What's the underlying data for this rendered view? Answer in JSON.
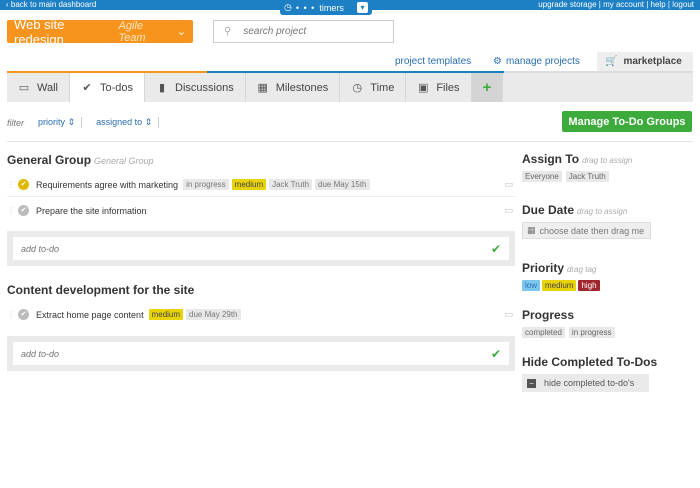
{
  "topbar": {
    "back": "back to main dashboard",
    "links": [
      "upgrade storage",
      "my account",
      "help",
      "logout"
    ],
    "separator": " | "
  },
  "timers": {
    "label": "timers",
    "dots": "• • •"
  },
  "project": {
    "name": "Web site redesign",
    "team": "Agile Team"
  },
  "search": {
    "placeholder": "search project"
  },
  "project_links": {
    "templates": "project templates",
    "manage": "manage projects",
    "marketplace": "marketplace"
  },
  "tabs": [
    {
      "label": "Wall",
      "icon": "speech-bubble-icon"
    },
    {
      "label": "To-dos",
      "icon": "checkmark-icon"
    },
    {
      "label": "Discussions",
      "icon": "discussion-icon"
    },
    {
      "label": "Milestones",
      "icon": "calendar-icon"
    },
    {
      "label": "Time",
      "icon": "clock-icon"
    },
    {
      "label": "Files",
      "icon": "briefcase-icon"
    },
    {
      "label": "+",
      "icon": "plus-icon"
    }
  ],
  "filter": {
    "label": "filter",
    "priority": "priority",
    "assigned": "assigned to",
    "sort_glyph": "⇕"
  },
  "manage_groups_button": "Manage To-Do Groups",
  "groups": [
    {
      "title": "General Group",
      "subtitle": "General Group",
      "items": [
        {
          "text": "Requirements agree with marketing",
          "done": true,
          "tags": [
            "in progress",
            "medium",
            "Jack Truth",
            "due May 15th"
          ]
        },
        {
          "text": "Prepare the site information",
          "done": false,
          "tags": []
        }
      ],
      "add_placeholder": "add to-do"
    },
    {
      "title": "Content development for the site",
      "subtitle": "",
      "items": [
        {
          "text": "Extract home page content",
          "done": false,
          "tags": [
            "medium",
            "due May 29th"
          ]
        }
      ],
      "add_placeholder": "add to-do"
    }
  ],
  "sidebar": {
    "assign": {
      "title": "Assign To",
      "hint": "drag to assign",
      "chips": [
        "Everyone",
        "Jack Truth"
      ]
    },
    "due": {
      "title": "Due Date",
      "hint": "drag to assign",
      "placeholder": "choose date then drag me"
    },
    "priority": {
      "title": "Priority",
      "hint": "drag tag",
      "chips": [
        "low",
        "medium",
        "high"
      ]
    },
    "progress": {
      "title": "Progress",
      "chips": [
        "completed",
        "in progress"
      ]
    },
    "hide": {
      "title": "Hide Completed To-Dos",
      "label": "hide completed to-do's"
    }
  },
  "colors": {
    "accent_blue": "#1d7fc4",
    "orange": "#f7941d",
    "green": "#3cab3c"
  }
}
